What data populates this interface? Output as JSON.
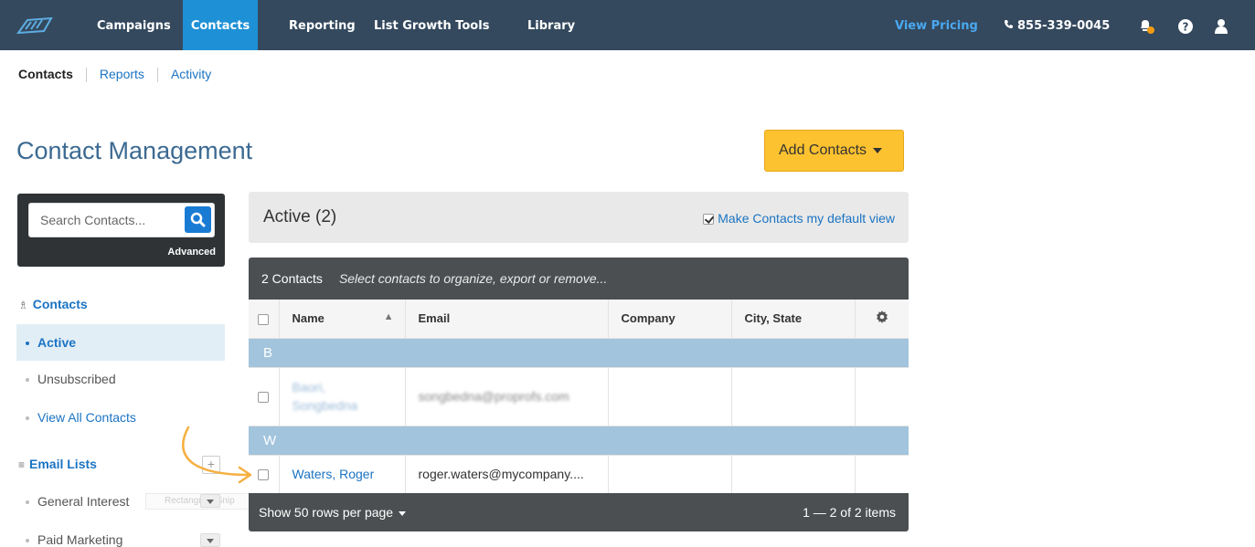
{
  "topnav": {
    "items": [
      "Campaigns",
      "Contacts",
      "Reporting",
      "List Growth Tools",
      "Library"
    ],
    "active": "Contacts",
    "pricing_label": "View Pricing",
    "phone": "855-339-0045",
    "icons": [
      "logo-icon",
      "phone-icon",
      "bell-icon",
      "help-icon",
      "user-icon"
    ],
    "colors": {
      "bar": "#34495e",
      "active": "#1e90d6",
      "pricing": "#4aa8f0",
      "notification_dot": "#f39c12"
    }
  },
  "subnav": {
    "items": [
      "Contacts",
      "Reports",
      "Activity"
    ]
  },
  "page": {
    "title": "Contact Management",
    "add_button_label": "Add Contacts"
  },
  "sidebar": {
    "search_placeholder": "Search Contacts...",
    "advanced_label": "Advanced",
    "contacts_heading": "Contacts",
    "contacts_items": [
      "Active",
      "Unsubscribed",
      "View All Contacts"
    ],
    "email_lists_heading": "Email Lists",
    "email_lists": [
      "General Interest",
      "Paid Marketing"
    ],
    "ghost_chip_text": "Rectangular Snip"
  },
  "main": {
    "status_title": "Active (2)",
    "default_view_label": "Make Contacts my default view",
    "default_view_checked": true,
    "count_label": "2 Contacts",
    "hint": "Select contacts to organize, export or remove...",
    "columns": [
      "Name",
      "Email",
      "Company",
      "City, State"
    ],
    "groups": [
      {
        "letter": "B",
        "rows": [
          {
            "name": "Baori, Songbedna",
            "email": "songbedna@proprofs.com",
            "company": "",
            "city": "",
            "blurred": true
          }
        ]
      },
      {
        "letter": "W",
        "rows": [
          {
            "name": "Waters, Roger",
            "email": "roger.waters@mycompany....",
            "company": "",
            "city": "",
            "blurred": false
          }
        ]
      }
    ],
    "rows_per_page_label": "Show 50 rows per page",
    "pagination": "1 — 2 of 2 items"
  }
}
